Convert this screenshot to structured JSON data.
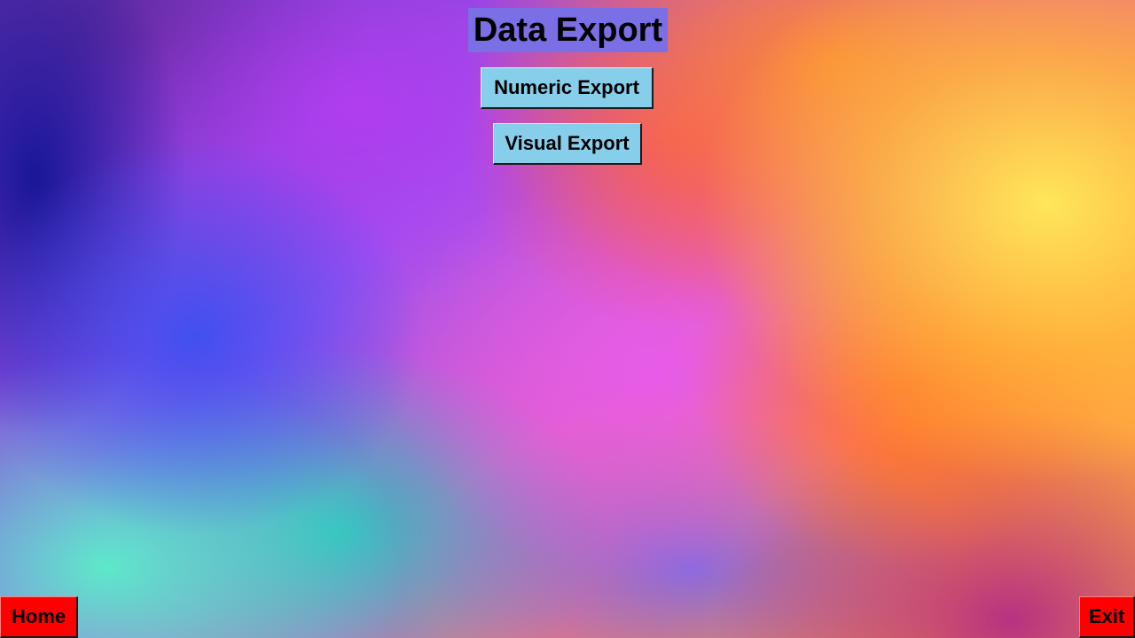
{
  "page": {
    "title": "Data Export"
  },
  "export_options": {
    "numeric_label": "Numeric Export",
    "visual_label": "Visual Export"
  },
  "navigation": {
    "home_label": "Home",
    "exit_label": "Exit"
  },
  "colors": {
    "title_background": "#7b6fe6",
    "option_button": "#87ceeb",
    "nav_button": "#ff0000"
  }
}
